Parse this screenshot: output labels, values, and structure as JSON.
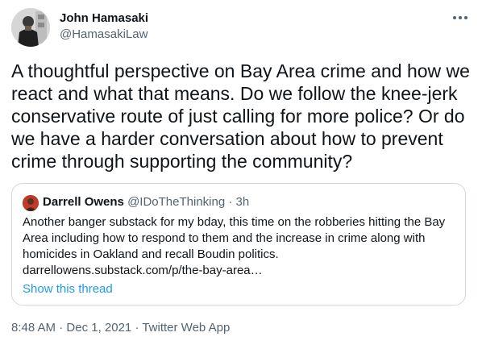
{
  "author": {
    "name": "John Hamasaki",
    "handle": "@HamasakiLaw",
    "avatar": "profile-photo"
  },
  "more_icon": "more-horizontal-icon",
  "tweet": {
    "text": "A thoughtful perspective on Bay Area crime and how we react and what that means. Do we follow the knee-jerk conservative route of just calling for more police? Or do we have a harder conversation about how to prevent crime through supporting the community?"
  },
  "quote": {
    "name": "Darrell Owens",
    "handle": "@IDoTheThinking",
    "separator": " · ",
    "time": "3h",
    "text": "Another banger substack for my bday, this time on the robberies hitting the Bay Area including how to respond to them and the increase in crime along with homicides in Oakland and recall Boudin politics.",
    "link": "darrellowens.substack.com/p/the-bay-area…",
    "show_thread": "Show this thread"
  },
  "meta": {
    "time": "8:48 AM",
    "separator1": " · ",
    "date": "Dec 1, 2021",
    "separator2": " · ",
    "source": "Twitter Web App"
  },
  "colors": {
    "text_primary": "#0f1419",
    "text_secondary": "#536471",
    "link": "#1d9bf0",
    "border": "#cfd9de"
  }
}
